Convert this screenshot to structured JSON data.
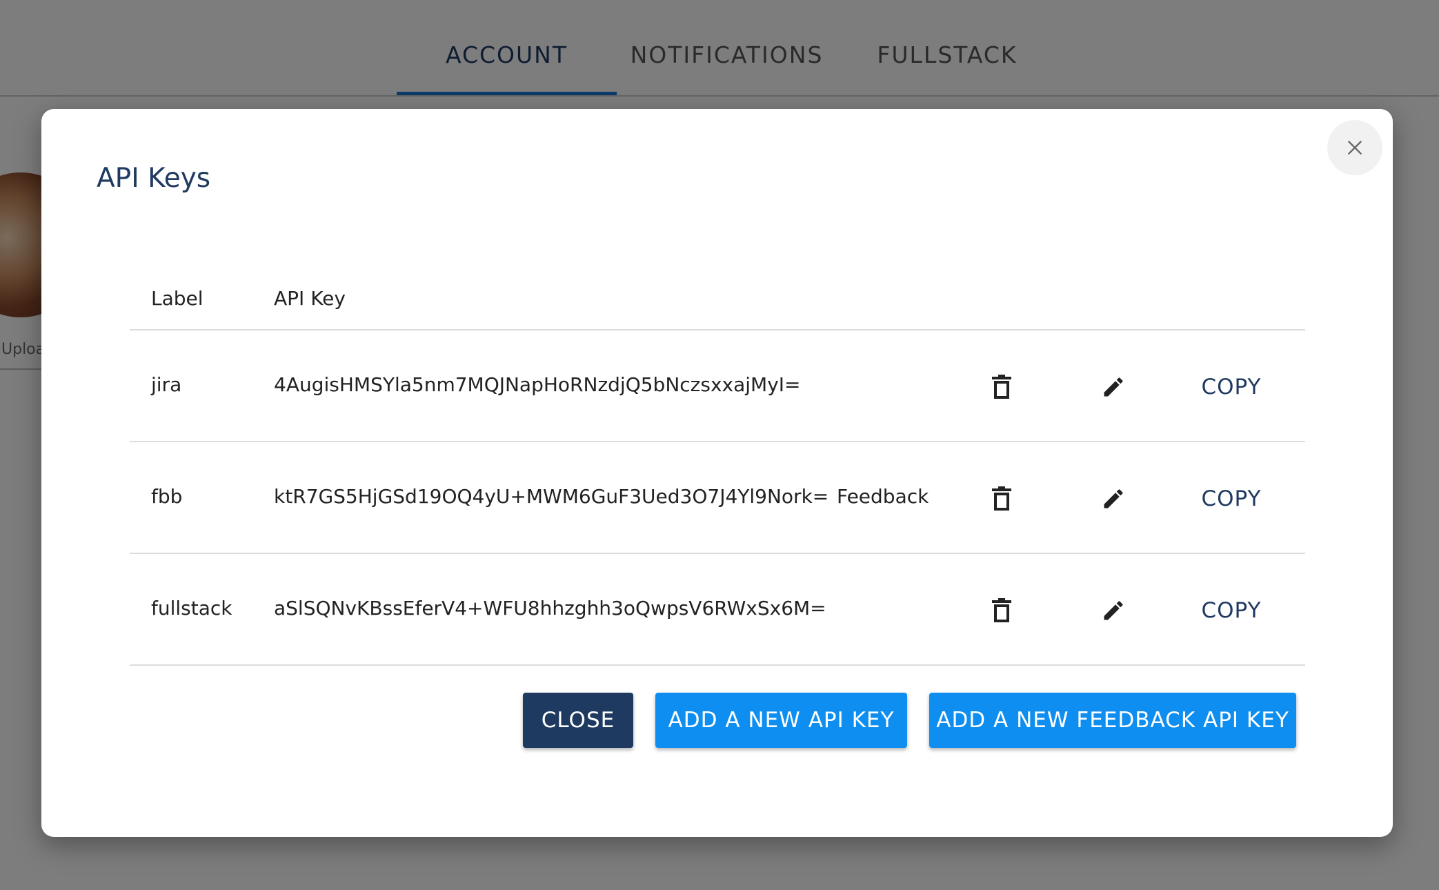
{
  "tabs": {
    "account": "ACCOUNT",
    "notifications": "NOTIFICATIONS",
    "fullstack": "FULLSTACK"
  },
  "background": {
    "upload_label": "Uploa"
  },
  "dialog": {
    "title": "API Keys",
    "columns": {
      "label": "Label",
      "api_key": "API Key"
    },
    "rows": [
      {
        "label": "jira",
        "api_key": "4AugisHMSYla5nm7MQJNapHoRNzdjQ5bNczsxxajMyI=",
        "type": "",
        "copy_label": "COPY"
      },
      {
        "label": "fbb",
        "api_key": "ktR7GS5HjGSd19OQ4yU+MWM6GuF3Ued3O7J4Yl9Nork=",
        "type": "Feedback",
        "copy_label": "COPY"
      },
      {
        "label": "fullstack",
        "api_key": "aSlSQNvKBssEferV4+WFU8hhzghh3oQwpsV6RWxSx6M=",
        "type": "",
        "copy_label": "COPY"
      }
    ],
    "buttons": {
      "close": "CLOSE",
      "add_key": "ADD A NEW API KEY",
      "add_feedback_key": "ADD A NEW FEEDBACK API KEY"
    }
  },
  "colors": {
    "primary_dark": "#1f3a60",
    "primary_blue": "#0d8ef0",
    "tab_indicator": "#1976d2"
  },
  "icons": [
    "close-icon",
    "delete-icon",
    "edit-icon"
  ]
}
